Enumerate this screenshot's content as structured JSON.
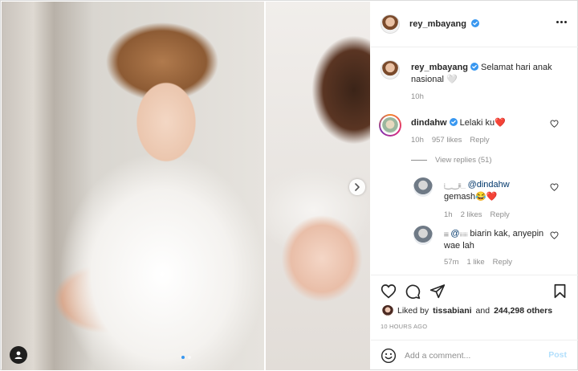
{
  "post": {
    "author": "rey_mbayang",
    "caption": "Selamat hari anak nasional 🤍",
    "caption_time": "10h",
    "carousel": {
      "current_slide": 1,
      "total_slides": 2
    }
  },
  "comments": [
    {
      "username": "dindahw",
      "verified": true,
      "text": "Lelaki ku❤️",
      "time": "10h",
      "likes": "957 likes",
      "reply_label": "Reply",
      "view_replies": "View replies (51)",
      "replies": [
        {
          "username_redacted": "ᵢ‿‿ᵢᵢᵢ_",
          "mention": "@dindahw",
          "text": "gemash😂❤️",
          "time": "1h",
          "likes": "2 likes",
          "reply_label": "Reply"
        },
        {
          "username_redacted": "ᵢᵢᵢᵢᵢ",
          "mention": "@",
          "mention_redacted": "ᵢᵢᵢᵢᵢᵢᵢᵢ",
          "text": "biarin kak, anyepin wae lah",
          "time": "57m",
          "likes": "1 like",
          "reply_label": "Reply"
        }
      ]
    }
  ],
  "footer": {
    "liked_by_prefix": "Liked by",
    "liked_by_user": "tissabiani",
    "liked_by_and": "and",
    "liked_by_others": "244,298 others",
    "time_ago": "10 HOURS AGO",
    "comment_placeholder": "Add a comment...",
    "post_label": "Post"
  },
  "icons": {
    "verified": "verified-badge-icon",
    "more": "more-options-icon",
    "heart": "heart-icon",
    "comment": "comment-icon",
    "share": "share-icon",
    "save": "bookmark-icon",
    "emoji": "emoji-icon",
    "next": "chevron-right-icon",
    "tags": "user-tag-icon"
  },
  "colors": {
    "verified_blue": "#3897f0",
    "active_dot": "#3897f0",
    "post_button": "#b2dffc",
    "meta_grey": "#8e8e8e"
  }
}
